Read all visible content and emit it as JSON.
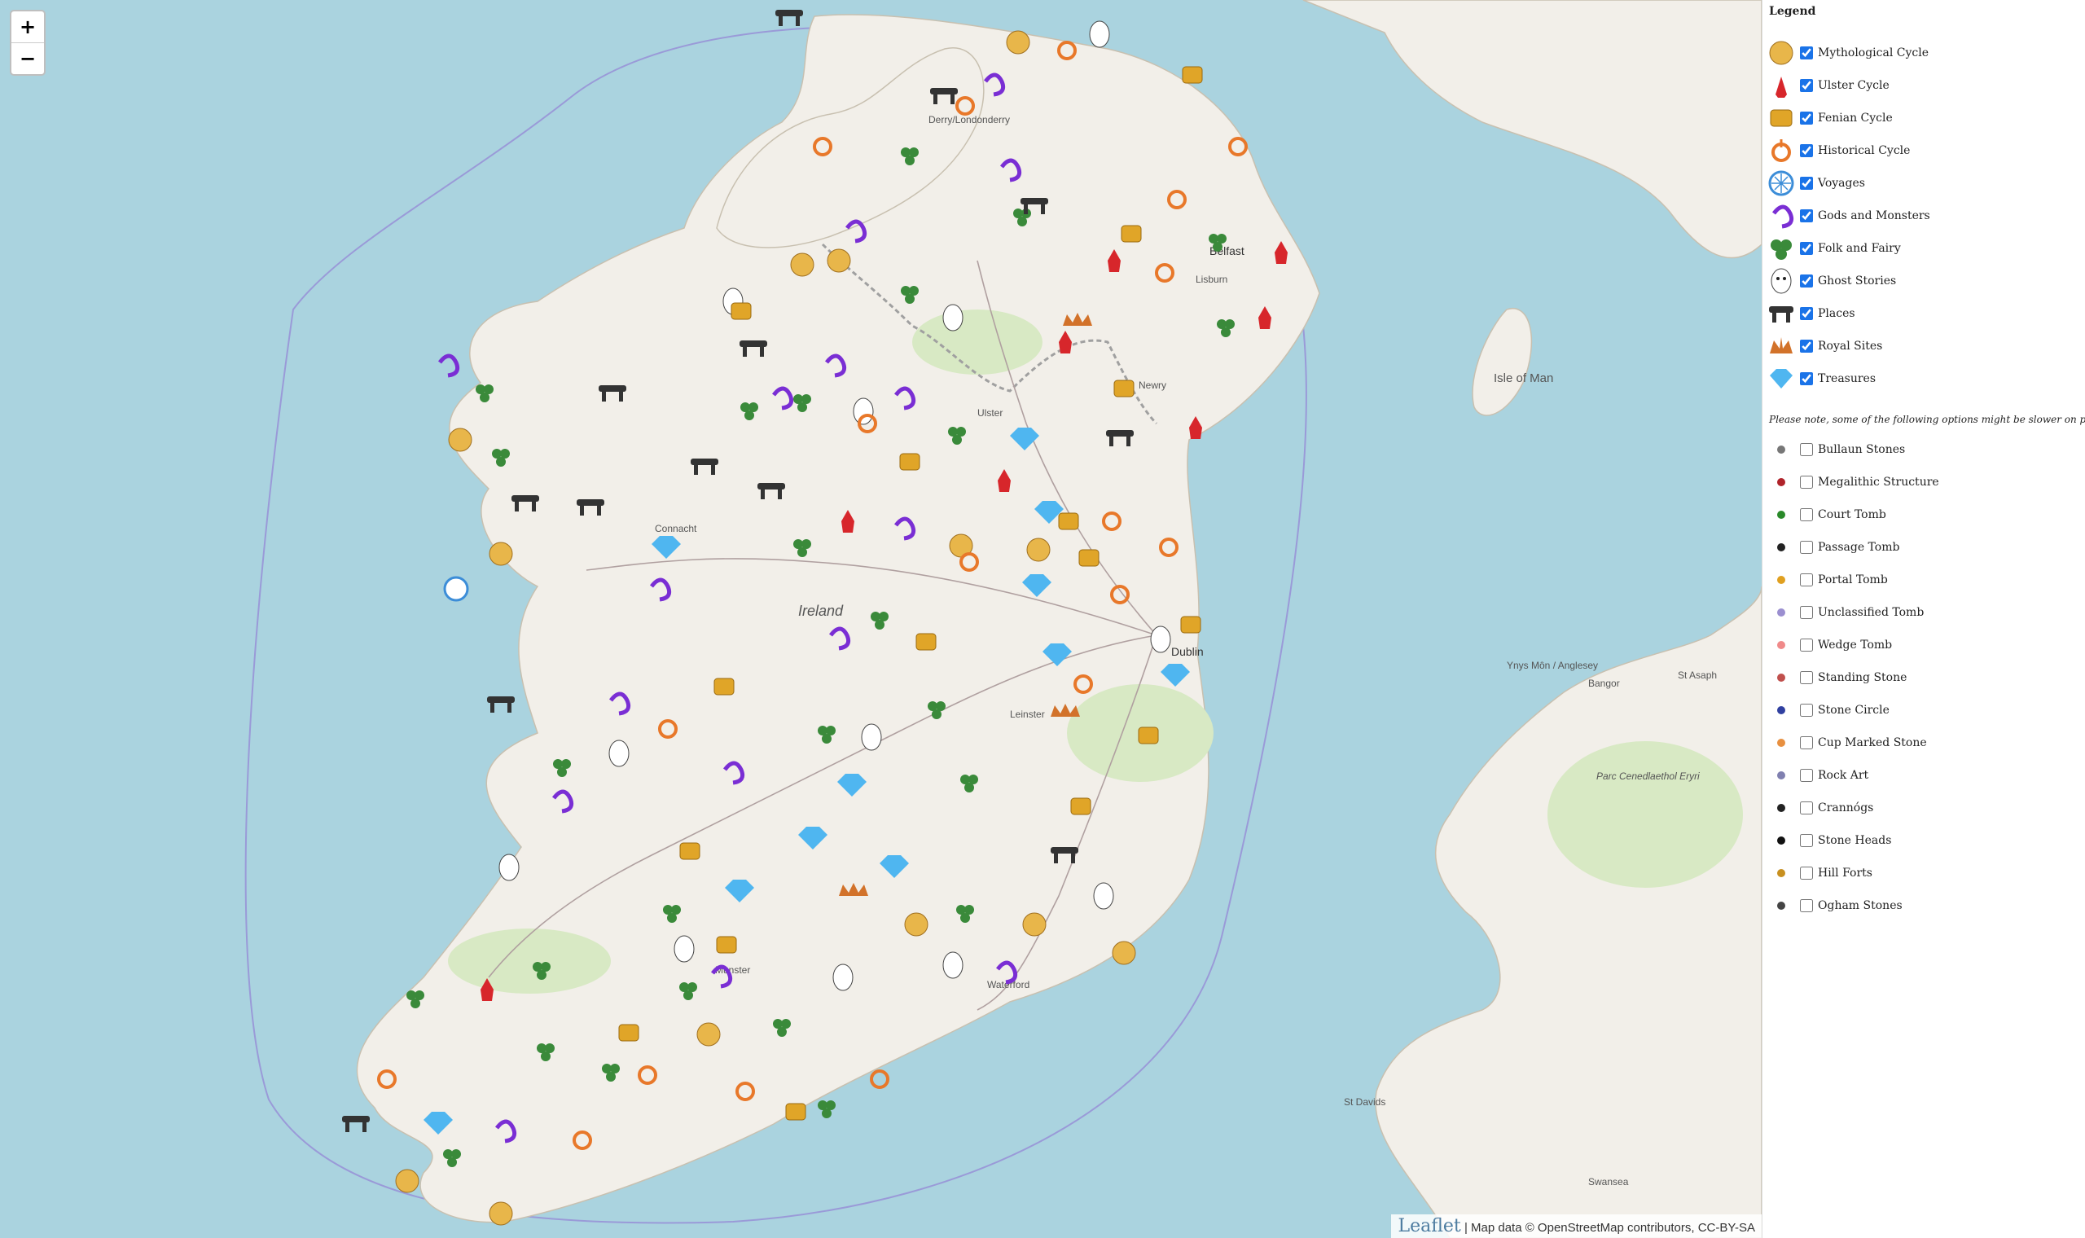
{
  "map": {
    "zoom_in": "+",
    "zoom_out": "−",
    "places": [
      {
        "name": "Derry/Londonderry"
      },
      {
        "name": "Belfast"
      },
      {
        "name": "Lisburn"
      },
      {
        "name": "Newry"
      },
      {
        "name": "Dublin"
      },
      {
        "name": "Ireland"
      },
      {
        "name": "Ulster"
      },
      {
        "name": "Connacht"
      },
      {
        "name": "Leinster"
      },
      {
        "name": "Munster"
      },
      {
        "name": "Waterford"
      },
      {
        "name": "Isle of Man"
      },
      {
        "name": "Bangor"
      },
      {
        "name": "St Asaph"
      },
      {
        "name": "Parc Cenedlaethol Eryri"
      },
      {
        "name": "St Davids"
      },
      {
        "name": "Swansea"
      },
      {
        "name": "Ynys Môn / Anglesey"
      }
    ],
    "attribution": {
      "leaflet": "Leaflet",
      "text": "| Map data © OpenStreetMap contributors, CC-BY-SA"
    }
  },
  "legend": {
    "title": "Legend",
    "categories": [
      {
        "label": "Mythological Cycle",
        "icon": "sun-orb-icon",
        "color": "#e8b64a",
        "checked": true
      },
      {
        "label": "Ulster Cycle",
        "icon": "red-hand-icon",
        "color": "#d7262b",
        "checked": true
      },
      {
        "label": "Fenian Cycle",
        "icon": "hounds-icon",
        "color": "#e0a528",
        "checked": true
      },
      {
        "label": "Historical Cycle",
        "icon": "brooch-icon",
        "color": "#e8782a",
        "checked": true
      },
      {
        "label": "Voyages",
        "icon": "compass-icon",
        "color": "#3c8dd8",
        "checked": true
      },
      {
        "label": "Gods and Monsters",
        "icon": "serpent-icon",
        "color": "#7a2ed4",
        "checked": true
      },
      {
        "label": "Folk and Fairy",
        "icon": "triskele-icon",
        "color": "#3a8a3a",
        "checked": true
      },
      {
        "label": "Ghost Stories",
        "icon": "ghost-icon",
        "color": "#2a2a2a",
        "checked": true
      },
      {
        "label": "Places",
        "icon": "dolmen-icon",
        "color": "#333333",
        "checked": true
      },
      {
        "label": "Royal Sites",
        "icon": "crown-icon",
        "color": "#d2722a",
        "checked": true
      },
      {
        "label": "Treasures",
        "icon": "gem-icon",
        "color": "#4fb6f0",
        "checked": true
      }
    ],
    "note": "Please note, some of the following options might be slower on phones:",
    "layers": [
      {
        "label": "Bullaun Stones",
        "color": "#777777",
        "checked": false
      },
      {
        "label": "Megalithic Structure",
        "color": "#b0232a",
        "checked": false
      },
      {
        "label": "Court Tomb",
        "color": "#2a8a2a",
        "checked": false
      },
      {
        "label": "Passage Tomb",
        "color": "#222222",
        "checked": false
      },
      {
        "label": "Portal Tomb",
        "color": "#e0a020",
        "checked": false
      },
      {
        "label": "Unclassified Tomb",
        "color": "#9b8fd0",
        "checked": false
      },
      {
        "label": "Wedge Tomb",
        "color": "#f08a8a",
        "checked": false
      },
      {
        "label": "Standing Stone",
        "color": "#c0504d",
        "checked": false
      },
      {
        "label": "Stone Circle",
        "color": "#3040a0",
        "checked": false
      },
      {
        "label": "Cup Marked Stone",
        "color": "#e89040",
        "checked": false
      },
      {
        "label": "Rock Art",
        "color": "#8080b0",
        "checked": false
      },
      {
        "label": "Crannógs",
        "color": "#222222",
        "checked": false
      },
      {
        "label": "Stone Heads",
        "color": "#111111",
        "checked": false
      },
      {
        "label": "Hill Forts",
        "color": "#c89020",
        "checked": false
      },
      {
        "label": "Ogham Stones",
        "color": "#444444",
        "checked": false
      }
    ]
  }
}
